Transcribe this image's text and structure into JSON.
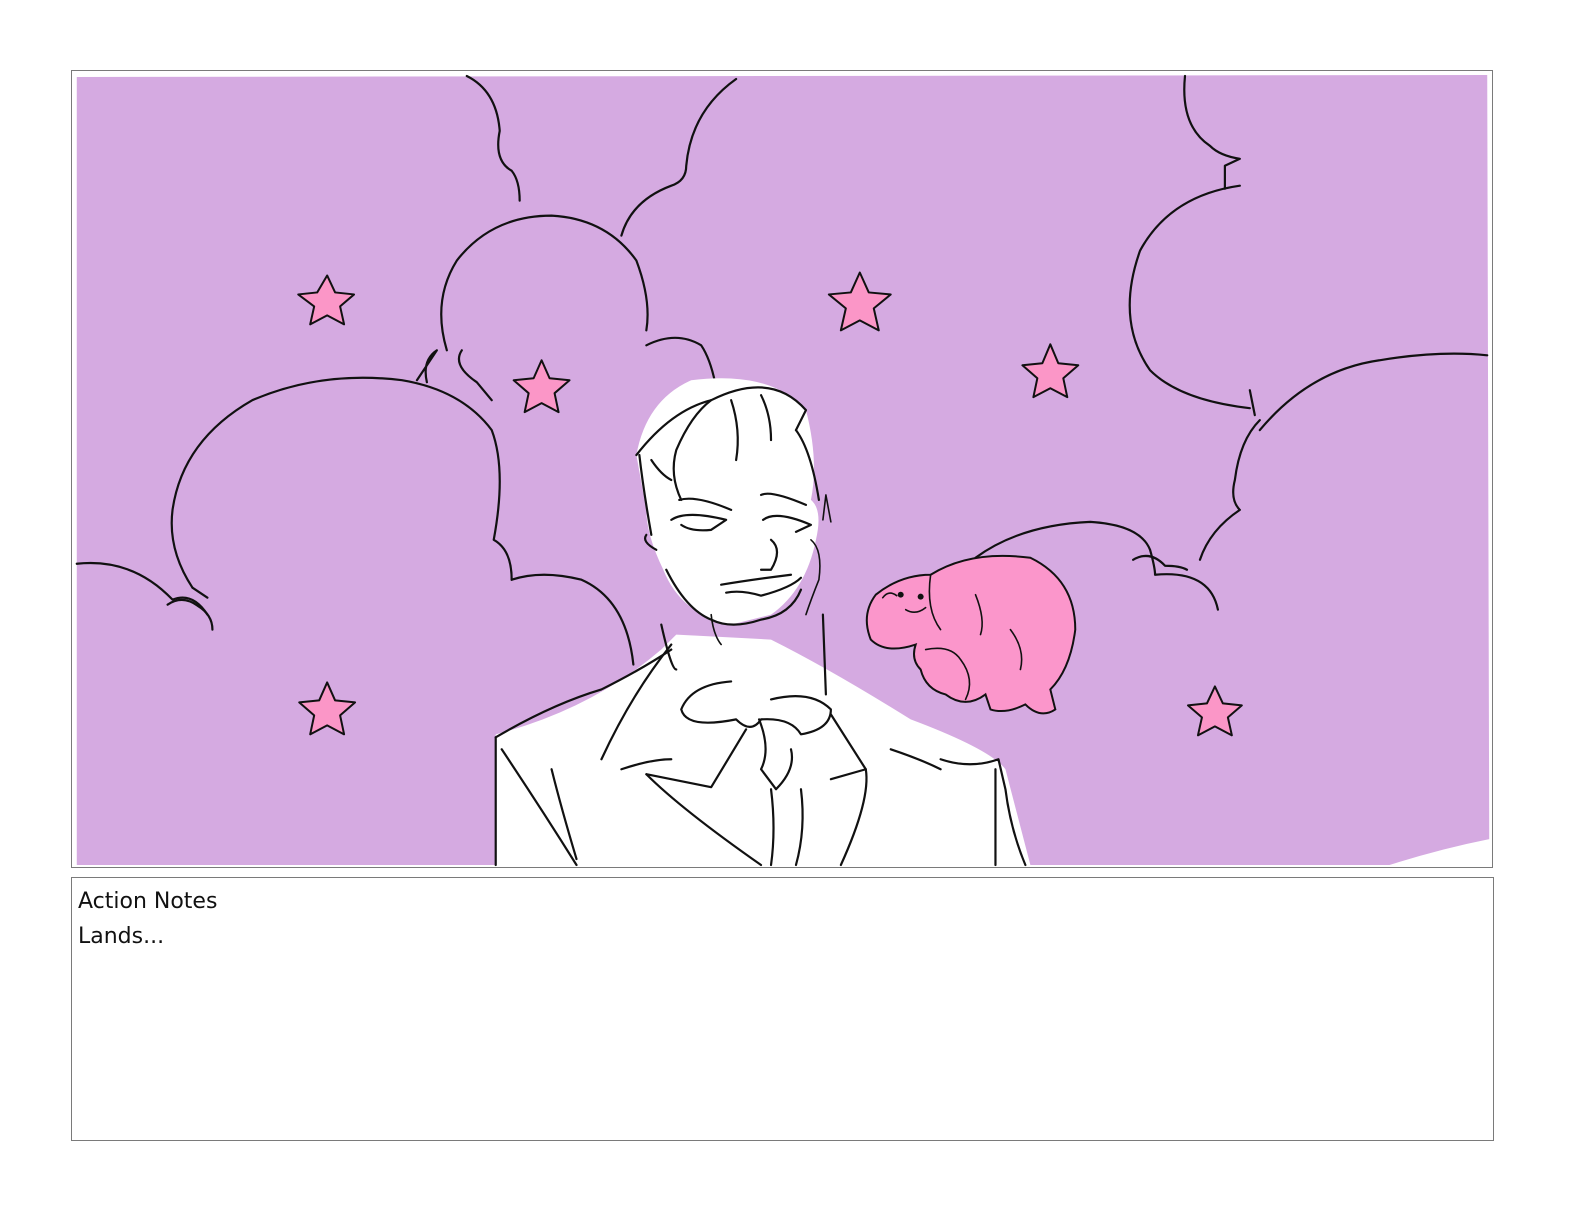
{
  "storyboard": {
    "notes_label": "Action Notes",
    "notes_text": "Lands..."
  },
  "colors": {
    "sky": "#d5aae1",
    "star": "#fb96c7",
    "creature": "#fb96cb",
    "line": "#111111",
    "frame_border": "#7a7a7a"
  },
  "panel": {
    "icons": [
      "cloud",
      "star",
      "man-in-tuxedo",
      "pink-creature"
    ]
  }
}
